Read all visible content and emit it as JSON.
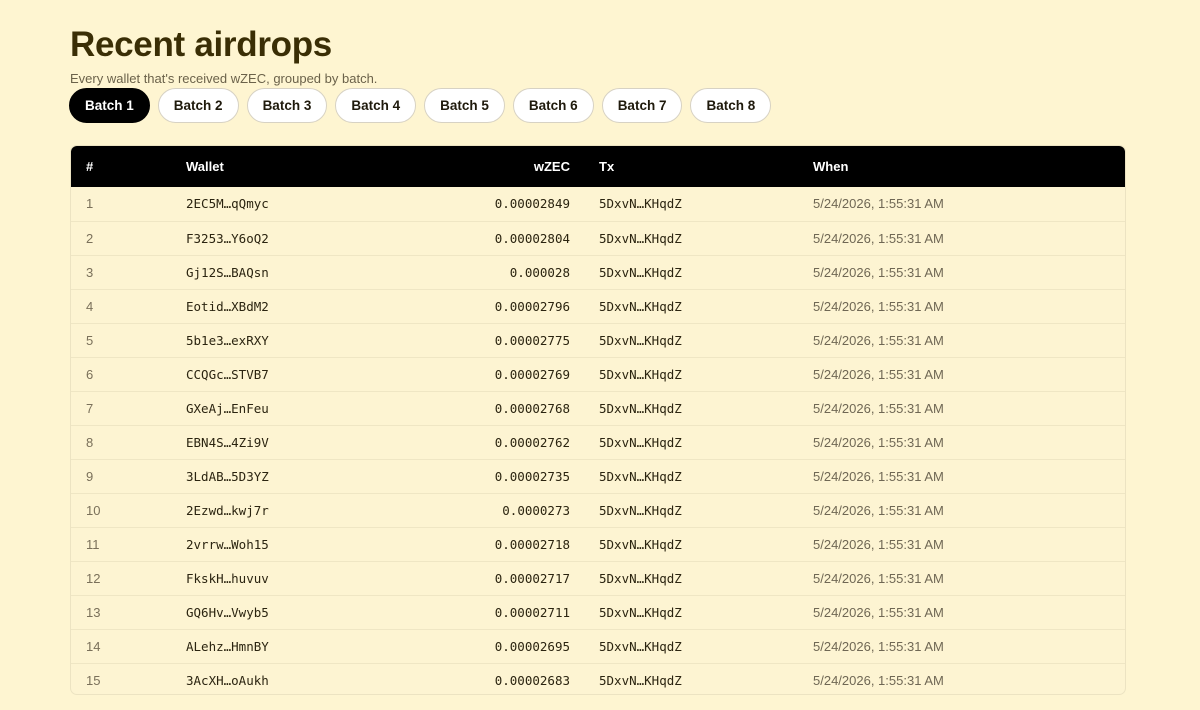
{
  "header": {
    "title": "Recent airdrops",
    "subtitle": "Every wallet that's received wZEC, grouped by batch."
  },
  "batches": {
    "active_index": 0,
    "tabs": [
      "Batch 1",
      "Batch 2",
      "Batch 3",
      "Batch 4",
      "Batch 5",
      "Batch 6",
      "Batch 7",
      "Batch 8"
    ]
  },
  "table": {
    "columns": {
      "num": "#",
      "wallet": "Wallet",
      "amount": "wZEC",
      "tx": "Tx",
      "when": "When"
    },
    "rows": [
      {
        "num": "1",
        "wallet": "2EC5M…qQmyc",
        "amount": "0.00002849",
        "tx": "5DxvN…KHqdZ",
        "when": "5/24/2026, 1:55:31 AM"
      },
      {
        "num": "2",
        "wallet": "F3253…Y6oQ2",
        "amount": "0.00002804",
        "tx": "5DxvN…KHqdZ",
        "when": "5/24/2026, 1:55:31 AM"
      },
      {
        "num": "3",
        "wallet": "Gj12S…BAQsn",
        "amount": "0.000028",
        "tx": "5DxvN…KHqdZ",
        "when": "5/24/2026, 1:55:31 AM"
      },
      {
        "num": "4",
        "wallet": "Eotid…XBdM2",
        "amount": "0.00002796",
        "tx": "5DxvN…KHqdZ",
        "when": "5/24/2026, 1:55:31 AM"
      },
      {
        "num": "5",
        "wallet": "5b1e3…exRXY",
        "amount": "0.00002775",
        "tx": "5DxvN…KHqdZ",
        "when": "5/24/2026, 1:55:31 AM"
      },
      {
        "num": "6",
        "wallet": "CCQGc…STVB7",
        "amount": "0.00002769",
        "tx": "5DxvN…KHqdZ",
        "when": "5/24/2026, 1:55:31 AM"
      },
      {
        "num": "7",
        "wallet": "GXeAj…EnFeu",
        "amount": "0.00002768",
        "tx": "5DxvN…KHqdZ",
        "when": "5/24/2026, 1:55:31 AM"
      },
      {
        "num": "8",
        "wallet": "EBN4S…4Zi9V",
        "amount": "0.00002762",
        "tx": "5DxvN…KHqdZ",
        "when": "5/24/2026, 1:55:31 AM"
      },
      {
        "num": "9",
        "wallet": "3LdAB…5D3YZ",
        "amount": "0.00002735",
        "tx": "5DxvN…KHqdZ",
        "when": "5/24/2026, 1:55:31 AM"
      },
      {
        "num": "10",
        "wallet": "2Ezwd…kwj7r",
        "amount": "0.0000273",
        "tx": "5DxvN…KHqdZ",
        "when": "5/24/2026, 1:55:31 AM"
      },
      {
        "num": "11",
        "wallet": "2vrrw…Woh15",
        "amount": "0.00002718",
        "tx": "5DxvN…KHqdZ",
        "when": "5/24/2026, 1:55:31 AM"
      },
      {
        "num": "12",
        "wallet": "FkskH…huvuv",
        "amount": "0.00002717",
        "tx": "5DxvN…KHqdZ",
        "when": "5/24/2026, 1:55:31 AM"
      },
      {
        "num": "13",
        "wallet": "GQ6Hv…Vwyb5",
        "amount": "0.00002711",
        "tx": "5DxvN…KHqdZ",
        "when": "5/24/2026, 1:55:31 AM"
      },
      {
        "num": "14",
        "wallet": "ALehz…HmnBY",
        "amount": "0.00002695",
        "tx": "5DxvN…KHqdZ",
        "when": "5/24/2026, 1:55:31 AM"
      },
      {
        "num": "15",
        "wallet": "3AcXH…oAukh",
        "amount": "0.00002683",
        "tx": "5DxvN…KHqdZ",
        "when": "5/24/2026, 1:55:31 AM"
      }
    ]
  },
  "colors": {
    "page_background": "#fef5d1",
    "title": "#3a2e05",
    "header_bar": "#000000",
    "active_tab": "#000000"
  }
}
